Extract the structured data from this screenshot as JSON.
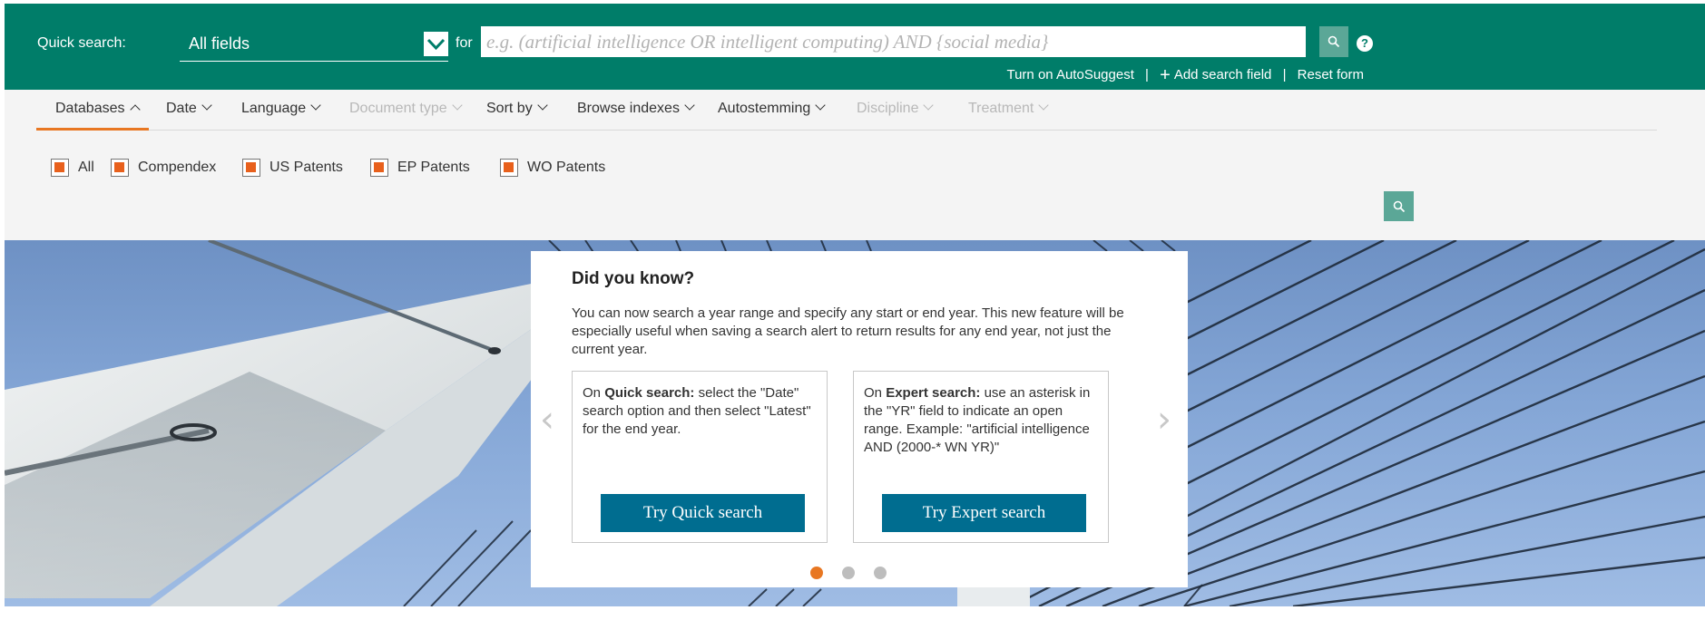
{
  "colors": {
    "brand_green": "#007d69",
    "search_button": "#5ba797",
    "accent_orange": "#e87722",
    "button_blue": "#006d90"
  },
  "search": {
    "label": "Quick search:",
    "field_value": "All fields",
    "for_label": "for",
    "placeholder": "e.g. (artificial intelligence OR intelligent computing) AND {social media}",
    "search_icon": "magnifier-icon",
    "help_icon": "?",
    "links": {
      "autosuggest": "Turn on AutoSuggest",
      "add_field": "Add search field",
      "reset": "Reset form"
    }
  },
  "tabs": [
    {
      "label": "Databases",
      "enabled": true,
      "active": true
    },
    {
      "label": "Date",
      "enabled": true
    },
    {
      "label": "Language",
      "enabled": true
    },
    {
      "label": "Document type",
      "enabled": false
    },
    {
      "label": "Sort by",
      "enabled": true
    },
    {
      "label": "Browse indexes",
      "enabled": true
    },
    {
      "label": "Autostemming",
      "enabled": true
    },
    {
      "label": "Discipline",
      "enabled": false
    },
    {
      "label": "Treatment",
      "enabled": false
    }
  ],
  "databases": [
    {
      "label": "All",
      "checked": true
    },
    {
      "label": "Compendex",
      "checked": true
    },
    {
      "label": "US Patents",
      "checked": true
    },
    {
      "label": "EP Patents",
      "checked": true
    },
    {
      "label": "WO Patents",
      "checked": true
    }
  ],
  "did_you_know": {
    "title": "Did you know?",
    "intro": "You can now search a year range and specify any start or end year. This new feature will be especially useful when saving a search alert to return results for any end year, not just the current year.",
    "tip1": {
      "lead": "On",
      "bold": "Quick search:",
      "rest": "select the \"Date\" search option and then select \"Latest\" for the end year.",
      "button": "Try Quick search"
    },
    "tip2": {
      "lead": "On",
      "bold": "Expert search:",
      "rest": "use an asterisk in the \"YR\" field to indicate an open range. Example: \"artificial intelligence AND (2000-* WN YR)\"",
      "button": "Try Expert search"
    },
    "prev_arrow": "‹",
    "next_arrow": "›",
    "active_slide": 1,
    "slide_count": 3
  }
}
